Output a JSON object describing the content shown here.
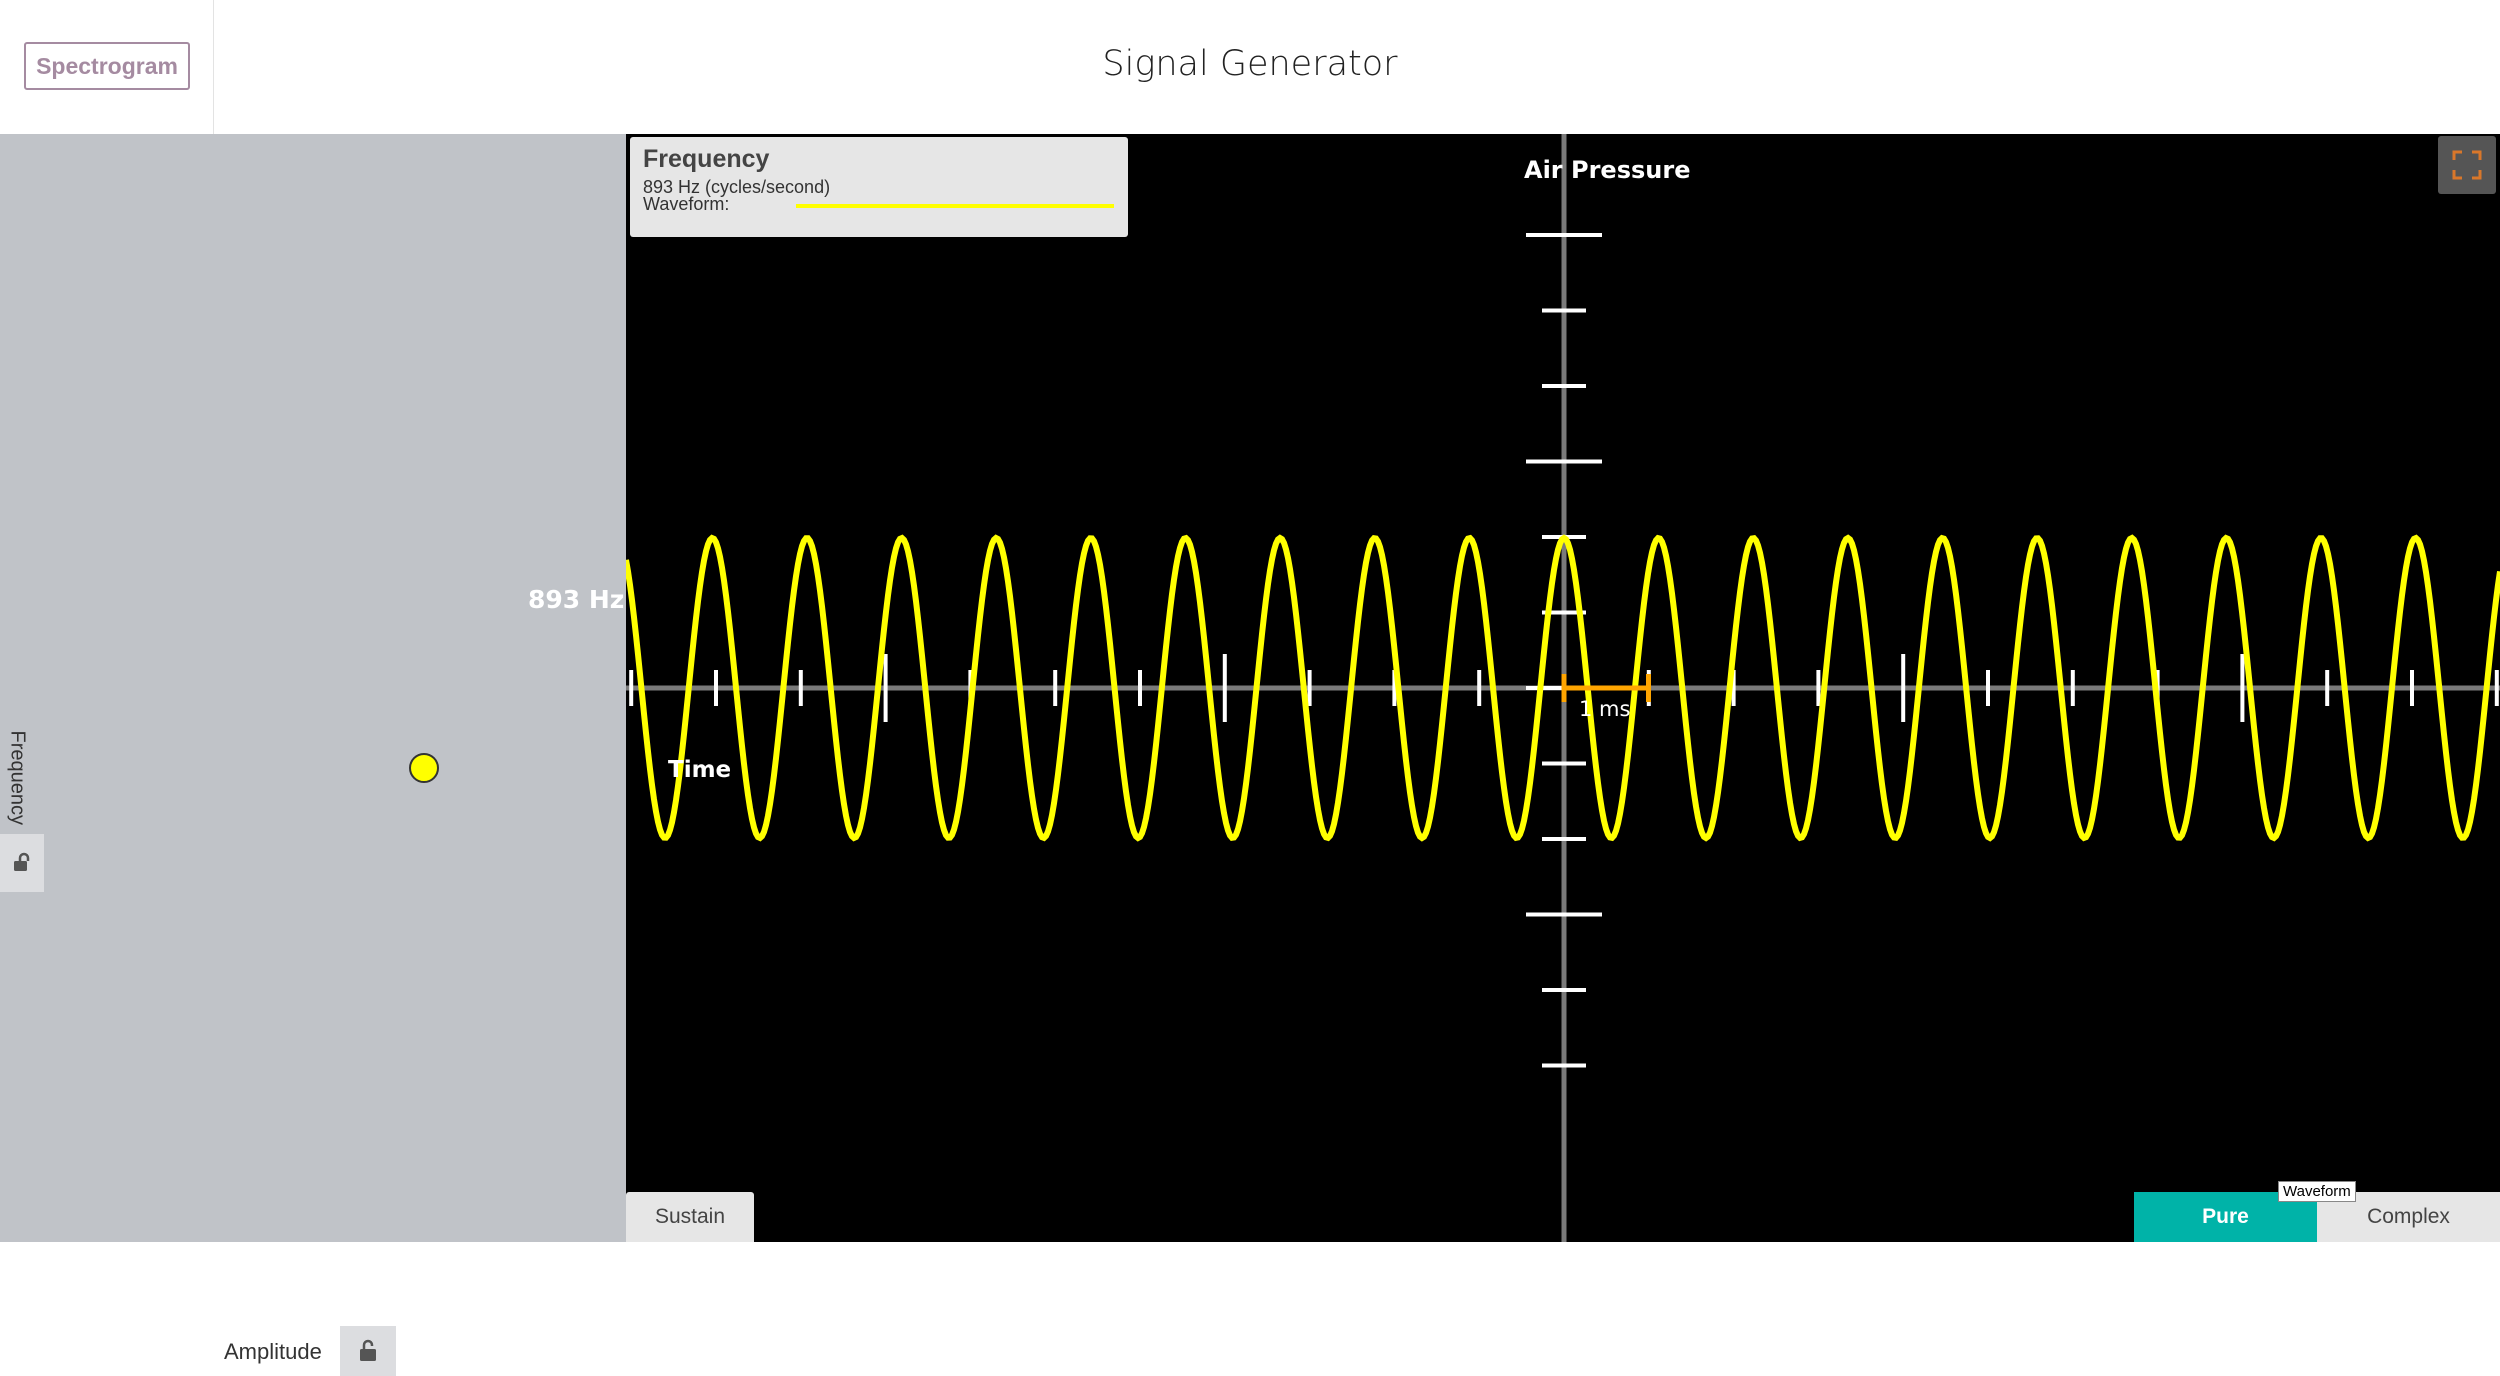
{
  "header": {
    "spectrogram_label": "Spectrogram",
    "title": "Signal Generator"
  },
  "left_panel": {
    "frequency_axis_label": "Frequency",
    "frequency_readout": "893 Hz",
    "amplitude_label": "Amplitude"
  },
  "info_box": {
    "title": "Frequency",
    "frequency_text": "893 Hz (cycles/second)",
    "waveform_label": "Waveform:"
  },
  "plot": {
    "y_axis_label": "Air Pressure",
    "x_axis_label": "Time",
    "scale_label": "1 ms",
    "frequency_hz": 893,
    "wave_color": "#ffff00",
    "scale_color": "#ffa500"
  },
  "controls": {
    "sustain_label": "Sustain",
    "pure_label": "Pure",
    "complex_label": "Complex",
    "waveform_tooltip": "Waveform",
    "selected_mode": "Pure"
  },
  "colors": {
    "accent": "#00b3a8",
    "panel_bg": "#c0c3c8",
    "spectrogram_border": "#a58ba1"
  }
}
